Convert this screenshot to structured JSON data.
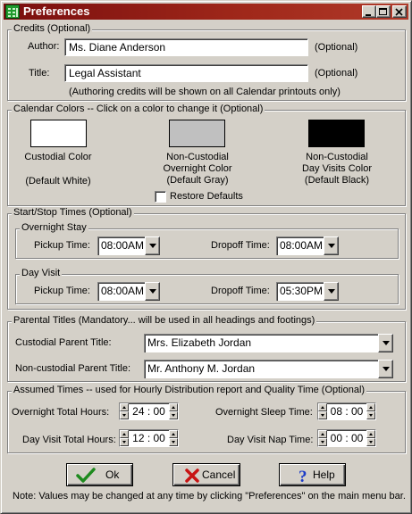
{
  "window": {
    "title": "Preferences",
    "controls": [
      "minimize-icon",
      "maximize-icon",
      "close-icon"
    ]
  },
  "credits": {
    "legend": "Credits (Optional)",
    "author_label": "Author:",
    "author_value": "Ms. Diane Anderson",
    "author_optional": "(Optional)",
    "title_label": "Title:",
    "title_value": "Legal Assistant",
    "title_optional": "(Optional)",
    "note": "(Authoring credits will be shown on all Calendar printouts only)"
  },
  "colors": {
    "legend": "Calendar Colors -- Click on a color to change it (Optional)",
    "custodial_label": "Custodial Color",
    "custodial_default": "(Default White)",
    "custodial_color": "#ffffff",
    "overnight_label_1": "Non-Custodial",
    "overnight_label_2": "Overnight Color",
    "overnight_default": "(Default Gray)",
    "overnight_color": "#c0c0c0",
    "dayvisit_label_1": "Non-Custodial",
    "dayvisit_label_2": "Day Visits Color",
    "dayvisit_default": "(Default Black)",
    "dayvisit_color": "#000000",
    "restore_label": "Restore Defaults",
    "restore_checked": false
  },
  "times": {
    "legend": "Start/Stop Times (Optional)",
    "overnight": {
      "legend": "Overnight Stay",
      "pickup_label": "Pickup Time:",
      "pickup_value": "08:00AM",
      "dropoff_label": "Dropoff Time:",
      "dropoff_value": "08:00AM"
    },
    "dayvisit": {
      "legend": "Day Visit",
      "pickup_label": "Pickup Time:",
      "pickup_value": "08:00AM",
      "dropoff_label": "Dropoff Time:",
      "dropoff_value": "05:30PM"
    }
  },
  "parental": {
    "legend": "Parental Titles (Mandatory... will be used in all headings and footings)",
    "custodial_label": "Custodial Parent Title:",
    "custodial_value": "Mrs. Elizabeth Jordan",
    "noncustodial_label": "Non-custodial Parent Title:",
    "noncustodial_value": "Mr. Anthony M. Jordan"
  },
  "assumed": {
    "legend": "Assumed Times -- used for Hourly Distribution report and Quality Time (Optional)",
    "overnight_total_label": "Overnight Total Hours:",
    "overnight_total_value": "24 : 00",
    "overnight_sleep_label": "Overnight Sleep Time:",
    "overnight_sleep_value": "08 : 00",
    "dayvisit_total_label": "Day Visit Total Hours:",
    "dayvisit_total_value": "12 : 00",
    "dayvisit_nap_label": "Day Visit Nap Time:",
    "dayvisit_nap_value": "00 : 00"
  },
  "buttons": {
    "ok_label": "Ok",
    "cancel_label": "Cancel",
    "help_label": "Help"
  },
  "footer_note": "Note:  Values may be changed at any time by clicking \"Preferences\" on the  main menu bar."
}
